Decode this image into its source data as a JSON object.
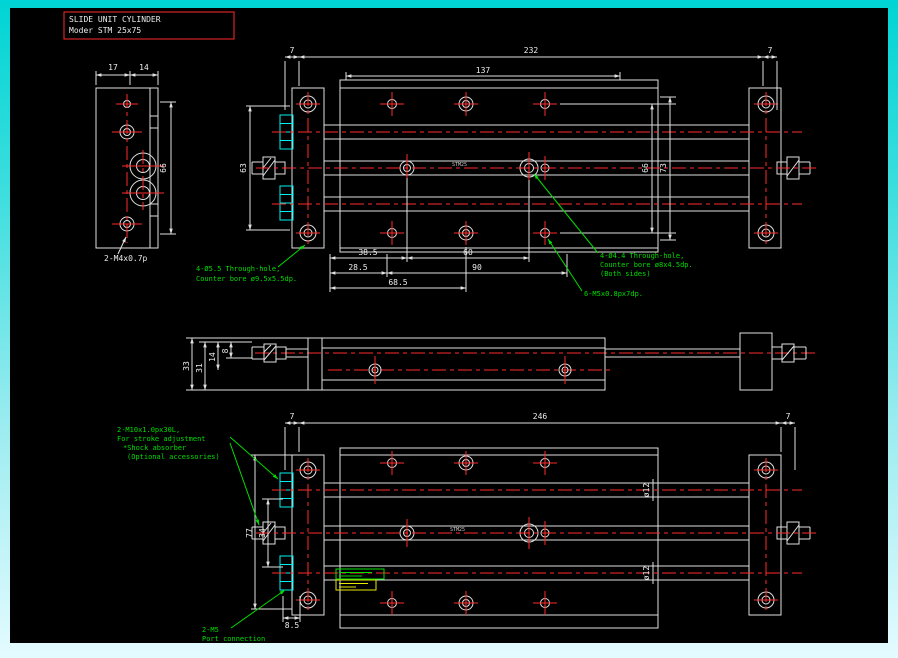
{
  "title_block": {
    "line1": "SLIDE UNIT CYLINDER",
    "line2": "Moder STM 25x75"
  },
  "end_view": {
    "dim_width_left": "17",
    "dim_width_right": "14",
    "dim_height": "66",
    "note_tap": "2-M4x0.7p"
  },
  "top_view": {
    "dim_7_left": "7",
    "dim_232": "232",
    "dim_7_right": "7",
    "dim_137": "137",
    "dim_63": "63",
    "dim_66": "66",
    "dim_73": "73",
    "dim_385": "38.5",
    "dim_60": "60",
    "dim_285": "28.5",
    "dim_90": "90",
    "dim_685": "68.5",
    "body_label": "STM25",
    "note_cbore_left": [
      "4-Ø5.5 Through-hole,",
      "Counter bore ø9.5x5.5dp."
    ],
    "note_cbore_right": [
      "4-Ø4.4 Through-hole,",
      "Counter bore ø8x4.5dp.",
      "(Both sides)"
    ],
    "note_tap": "6-M5x0.8px7dp."
  },
  "side_view": {
    "dim_33": "33",
    "dim_31": "31",
    "dim_14": "14",
    "dim_8": "8"
  },
  "bottom_view": {
    "dim_7_left": "7",
    "dim_246": "246",
    "dim_7_right": "7",
    "dim_77": "77",
    "dim_34": "34",
    "dim_rod1": "ø12",
    "dim_rod2": "ø12",
    "dim_85": "8.5",
    "body_label": "STM25",
    "note_stroke": [
      "2-M10x1.0px30L,",
      "For stroke adjustment",
      "*Shock absorber",
      "(Optional accessories)"
    ],
    "note_port": [
      "2-M5",
      "Port connection"
    ]
  }
}
